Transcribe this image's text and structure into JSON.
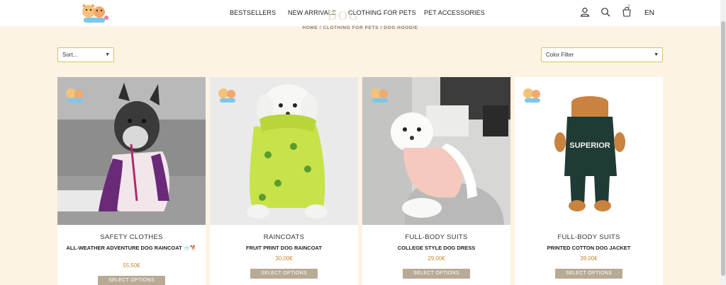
{
  "nav": {
    "items": [
      {
        "label": "BESTSELLERS"
      },
      {
        "label": "NEW ARRIVALS"
      },
      {
        "label": "CLOTHING FOR PETS"
      },
      {
        "label": "PET ACCESSORIES"
      }
    ],
    "cart_count": "2",
    "language": "EN"
  },
  "page": {
    "ghost_title": "DOG",
    "breadcrumb": [
      {
        "label": "HOME"
      },
      {
        "label": "CLOTHING FOR PETS"
      },
      {
        "label": "DOG HOODIE"
      }
    ],
    "separator": "/"
  },
  "filters": {
    "sort_value": "Sort...",
    "color_value": "Color Filter"
  },
  "products": [
    {
      "category": "SAFETY CLOTHES",
      "name": "ALL-WEATHER ADVENTURE DOG RAINCOAT 🌧️🐕",
      "price": "55.50€",
      "button": "SELECT OPTIONS"
    },
    {
      "category": "RAINCOATS",
      "name": "FRUIT PRINT DOG RAINCOAT",
      "price": "30,00€",
      "button": "SELECT OPTIONS"
    },
    {
      "category": "FULL-BODY SUITS",
      "name": "COLLEGE STYLE DOG DRESS",
      "price": "29,00€",
      "button": "SELECT OPTIONS"
    },
    {
      "category": "FULL-BODY SUITS",
      "name": "PRINTED COTTON DOG JACKET",
      "price": "39,00€",
      "button": "SELECT OPTIONS"
    }
  ],
  "product4_print": "SUPERIOR",
  "colors": {
    "accent": "#c9862f",
    "button": "#b9aa96",
    "background": "#fdf3e2",
    "select_border": "#d8c070"
  }
}
